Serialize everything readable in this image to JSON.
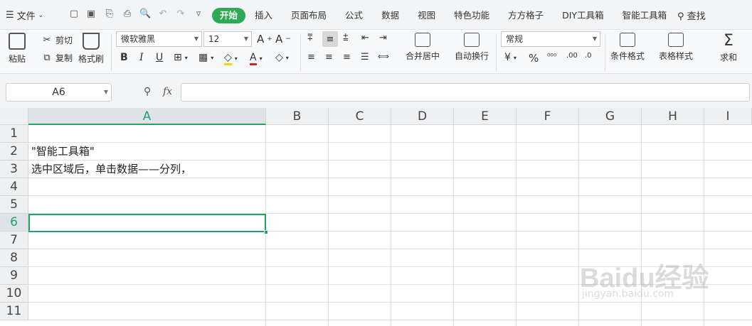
{
  "menubar": {
    "file_label": "文件",
    "tabs": [
      "开始",
      "插入",
      "页面布局",
      "公式",
      "数据",
      "视图",
      "特色功能",
      "方方格子",
      "DIY工具箱",
      "智能工具箱"
    ],
    "active_tab": "开始",
    "search_label": "查找"
  },
  "ribbon": {
    "paste": "粘贴",
    "cut": "剪切",
    "copy": "复制",
    "format_painter": "格式刷",
    "font_name": "微软雅黑",
    "font_size": "12",
    "merge_center": "合并居中",
    "wrap_text": "自动换行",
    "number_format": "常规",
    "conditional_format": "条件格式",
    "table_style": "表格样式",
    "sum": "求和"
  },
  "formula_bar": {
    "name_box": "A6",
    "fx_label": "fx",
    "formula": ""
  },
  "grid": {
    "columns": [
      "A",
      "B",
      "C",
      "D",
      "E",
      "F",
      "G",
      "H",
      "I"
    ],
    "rows": [
      "1",
      "2",
      "3",
      "4",
      "5",
      "6",
      "7",
      "8",
      "9",
      "10",
      "11"
    ],
    "selected_column": "A",
    "selected_row": "6",
    "cells": {
      "A2": "\"智能工具箱\"",
      "A3": "选中区域后，单击数据——分列，"
    }
  },
  "watermark": {
    "brand": "Baidu经验",
    "url": "jingyan.baidu.com"
  },
  "colors": {
    "accent": "#2cab54",
    "selection": "#21a366"
  }
}
